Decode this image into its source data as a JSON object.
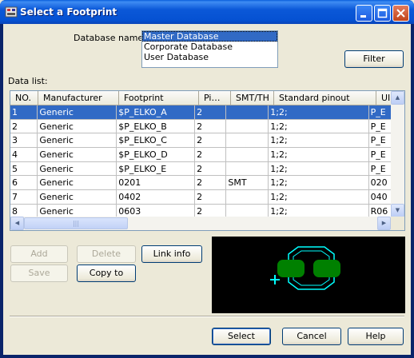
{
  "window": {
    "title": "Select a Footprint"
  },
  "database": {
    "label": "Database name:",
    "options": [
      "Master Database",
      "Corporate Database",
      "User Database"
    ],
    "selected_index": 0
  },
  "filter_label": "Filter",
  "data_list_label": "Data list:",
  "grid": {
    "columns": [
      "NO.",
      "Manufacturer",
      "Footprint",
      "Pi…",
      "SMT/TH",
      "Standard pinout",
      "UI"
    ],
    "rows": [
      [
        "1",
        "Generic",
        "$P_ELKO_A",
        "2",
        "",
        "1;2;",
        "P_E"
      ],
      [
        "2",
        "Generic",
        "$P_ELKO_B",
        "2",
        "",
        "1;2;",
        "P_E"
      ],
      [
        "3",
        "Generic",
        "$P_ELKO_C",
        "2",
        "",
        "1;2;",
        "P_E"
      ],
      [
        "4",
        "Generic",
        "$P_ELKO_D",
        "2",
        "",
        "1;2;",
        "P_E"
      ],
      [
        "5",
        "Generic",
        "$P_ELKO_E",
        "2",
        "",
        "1;2;",
        "P_E"
      ],
      [
        "6",
        "Generic",
        "0201",
        "2",
        "SMT",
        "1;2;",
        "020"
      ],
      [
        "7",
        "Generic",
        "0402",
        "2",
        "",
        "1;2;",
        "040"
      ],
      [
        "8",
        "Generic",
        "0603",
        "2",
        "",
        "1;2;",
        "R06"
      ]
    ],
    "selected_row": 0,
    "thumb_glyph": "|||"
  },
  "buttons": {
    "add": "Add",
    "delete": "Delete",
    "link_info": "Link info",
    "save": "Save",
    "copy_to": "Copy to",
    "select": "Select",
    "cancel": "Cancel",
    "help": "Help"
  },
  "colors": {
    "selection": "#316ac5",
    "title_bar": "#0551d2",
    "preview_bg": "#000000",
    "preview_outline": "#00ffff",
    "preview_pad": "#008000"
  }
}
